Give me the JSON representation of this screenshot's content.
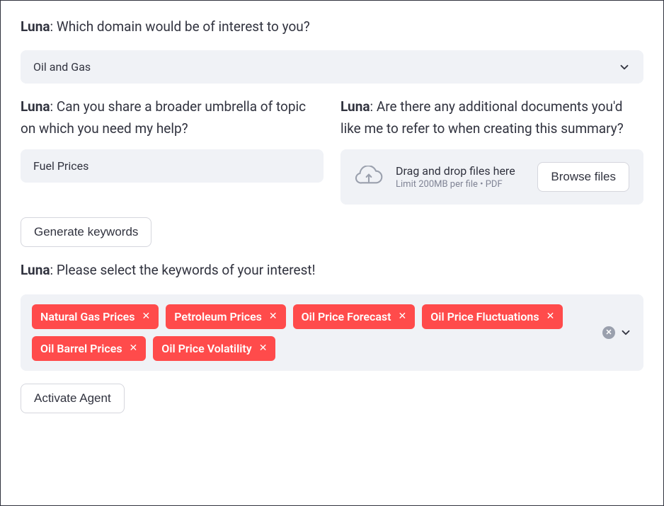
{
  "speaker": "Luna",
  "prompts": {
    "domain": "Which domain would be of interest to you?",
    "topic": "Can you share a broader umbrella of topic on which you need my help?",
    "docs": "Are there any additional documents you'd like me to refer to when creating this summary?",
    "keywords": "Please select the keywords of your interest!"
  },
  "domain_select": {
    "value": "Oil and Gas"
  },
  "topic_input": {
    "value": "Fuel Prices"
  },
  "uploader": {
    "drag_text": "Drag and drop files here",
    "limit_text": "Limit 200MB per file • PDF",
    "browse_button": "Browse files"
  },
  "buttons": {
    "generate_keywords": "Generate keywords",
    "activate_agent": "Activate Agent"
  },
  "keywords": [
    "Natural Gas Prices",
    "Petroleum Prices",
    "Oil Price Forecast",
    "Oil Price Fluctuations",
    "Oil Barrel Prices",
    "Oil Price Volatility"
  ]
}
